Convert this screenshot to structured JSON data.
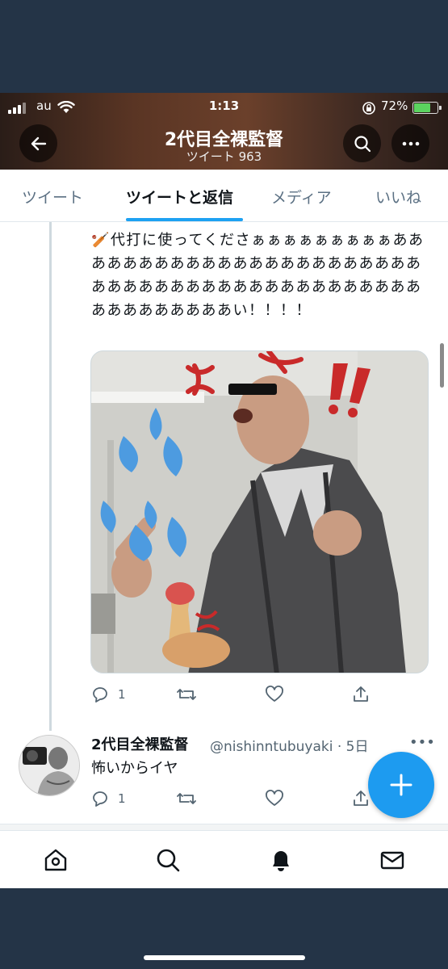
{
  "status_bar": {
    "carrier": "au",
    "time": "1:13",
    "battery": "72%",
    "battery_level": 0.72
  },
  "header": {
    "title": "2代目全裸監督",
    "subtitle": "ツイート 963",
    "icons": {
      "back": "arrow-left-icon",
      "search": "search-icon",
      "more": "more-horizontal-icon"
    }
  },
  "tabs": [
    {
      "label": "ツイート",
      "active": false
    },
    {
      "label": "ツイートと返信",
      "active": true
    },
    {
      "label": "メディア",
      "active": false
    },
    {
      "label": "いいね",
      "active": false
    }
  ],
  "tweet": {
    "text": "🏏代打に使ってくださぁぁぁぁぁぁぁぁぁあああああああああああああああああああああああああああああああああああああああああああああああああああああい！！！！",
    "media_alt": "photo",
    "stats": {
      "replies": "1",
      "retweets": "",
      "likes": ""
    }
  },
  "reply": {
    "name": "2代目全裸監督",
    "handle": "@nishinntubuyaki · 5日",
    "text": "怖いからイヤ",
    "stats": {
      "replies": "1",
      "retweets": "",
      "likes": ""
    }
  },
  "nav": [
    "home-icon",
    "search-icon",
    "notifications-icon",
    "messages-icon"
  ],
  "colors": {
    "accent": "#1d9bf0",
    "text": "#0f1419",
    "secondary": "#536471"
  }
}
